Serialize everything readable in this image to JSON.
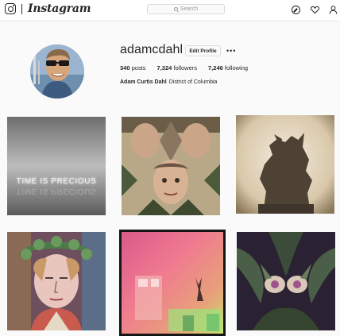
{
  "nav": {
    "brand": "Instagram",
    "search_placeholder": "Search",
    "icons": [
      "instagram-logo-icon",
      "explore-compass-icon",
      "heart-icon",
      "profile-icon"
    ]
  },
  "profile": {
    "username": "adamcdahl",
    "edit_label": "Edit Profile",
    "more_label": "•••",
    "posts_count": "340",
    "posts_label": "posts",
    "followers_count": "7,324",
    "followers_label": "followers",
    "following_count": "7,246",
    "following_label": "following",
    "full_name": "Adam Curtis Dahl",
    "location": "District of Columbia"
  },
  "posts": [
    {
      "overlay_text": "TIME IS PRECIOUS"
    },
    {
      "overlay_text": ""
    },
    {
      "overlay_text": ""
    },
    {
      "overlay_text": ""
    },
    {
      "overlay_text": ""
    },
    {
      "overlay_text": ""
    }
  ],
  "colors": {
    "accent": "#262626",
    "border": "#dbdbdb",
    "background": "#fafafa"
  }
}
